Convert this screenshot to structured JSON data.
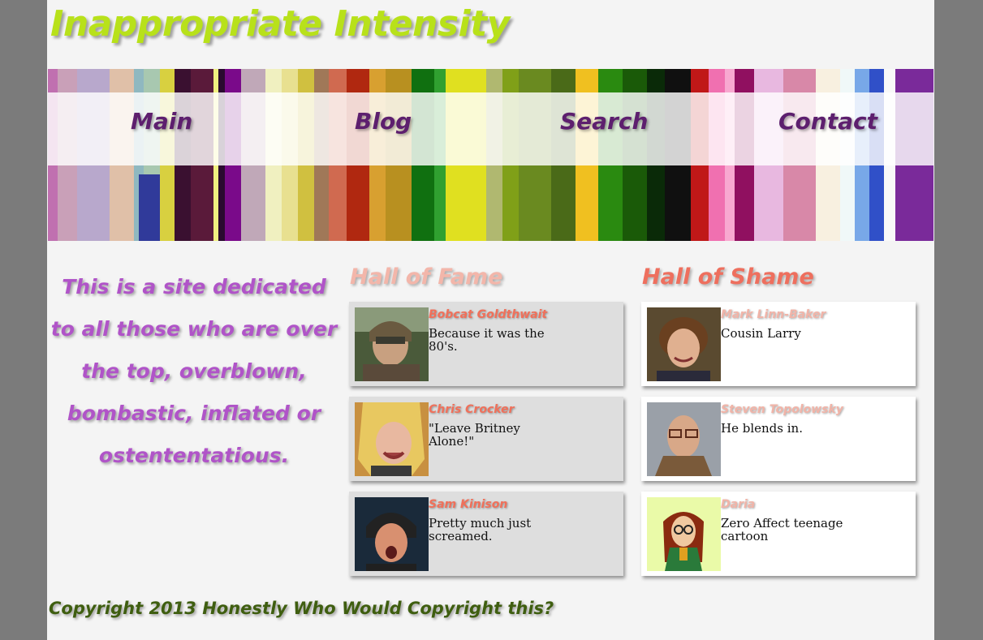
{
  "site": {
    "title": "Inappropriate Intensity"
  },
  "nav": {
    "items": [
      {
        "label": "Main"
      },
      {
        "label": "Blog"
      },
      {
        "label": "Search"
      },
      {
        "label": "Contact"
      }
    ]
  },
  "intro": {
    "text": "This is a site dedicated to all those who are over the top, overblown, bombastic, inflated or ostententatious."
  },
  "hall_of_fame": {
    "title": "Hall of Fame",
    "entries": [
      {
        "name": "Bobcat Goldthwait",
        "description": "Because it was the 80's."
      },
      {
        "name": "Chris Crocker",
        "description": "\"Leave Britney Alone!\""
      },
      {
        "name": "Sam Kinison",
        "description": "Pretty much just screamed."
      }
    ]
  },
  "hall_of_shame": {
    "title": "Hall of Shame",
    "entries": [
      {
        "name": "Mark Linn-Baker",
        "description": "Cousin Larry"
      },
      {
        "name": "Steven Topolowsky",
        "description": "He blends in."
      },
      {
        "name": "Daria",
        "description": "Zero Affect teenage cartoon"
      }
    ]
  },
  "footer": {
    "text": "Copyright 2013 Honestly Who Would Copyright this?"
  }
}
